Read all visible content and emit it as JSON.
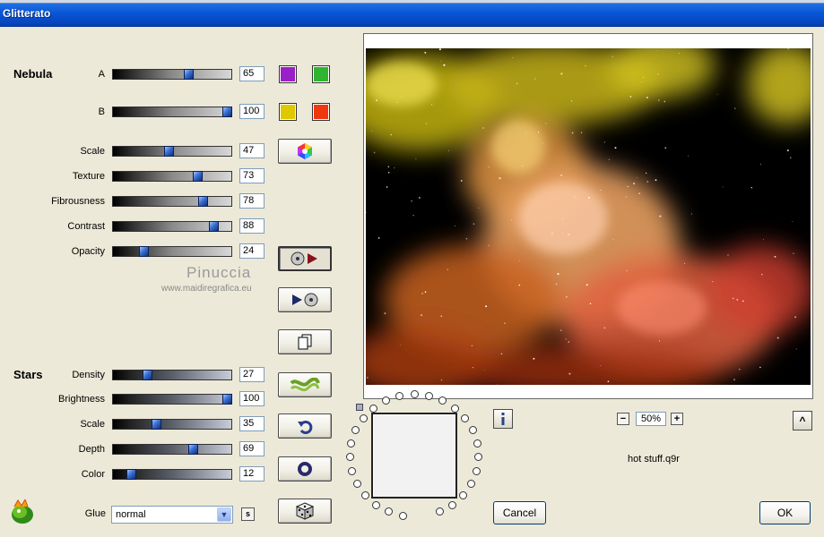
{
  "window": {
    "title": "Glitterato"
  },
  "nebula": {
    "label": "Nebula",
    "rows": [
      {
        "label": "A",
        "value": "65",
        "fraction": 0.65
      },
      {
        "label": "B",
        "value": "100",
        "fraction": 1.0
      },
      {
        "label": "Scale",
        "value": "47",
        "fraction": 0.47
      },
      {
        "label": "Texture",
        "value": "73",
        "fraction": 0.73
      },
      {
        "label": "Fibrousness",
        "value": "78",
        "fraction": 0.78
      },
      {
        "label": "Contrast",
        "value": "88",
        "fraction": 0.88
      },
      {
        "label": "Opacity",
        "value": "24",
        "fraction": 0.24
      }
    ],
    "colors": {
      "a1": "#9b1fc8",
      "a2": "#2fb52f",
      "b1": "#e0c800",
      "b2": "#f0380f"
    }
  },
  "stars": {
    "label": "Stars",
    "rows": [
      {
        "label": "Density",
        "value": "27",
        "fraction": 0.27
      },
      {
        "label": "Brightness",
        "value": "100",
        "fraction": 1.0
      },
      {
        "label": "Scale",
        "value": "35",
        "fraction": 0.35
      },
      {
        "label": "Depth",
        "value": "69",
        "fraction": 0.69
      },
      {
        "label": "Color",
        "value": "12",
        "fraction": 0.12
      }
    ]
  },
  "glue": {
    "label": "Glue",
    "selected": "normal",
    "side_button": "s"
  },
  "watermark": {
    "name": "Pinuccia",
    "url": "www.maidiregrafica.eu"
  },
  "preview": {
    "zoom": "50%",
    "filename": "hot stuff.q9r"
  },
  "icons": {
    "color-wheel": "color-wheel-icon",
    "save": "save-preset-icon",
    "load": "load-preset-icon",
    "copy": "copy-icon",
    "wave": "wave-icon",
    "undo": "undo-icon",
    "ring": "ring-icon",
    "dice": "dice-icon",
    "info": "info-icon",
    "logo": "app-logo-icon"
  },
  "buttons": {
    "cancel": "Cancel",
    "ok": "OK",
    "zoom_out": "−",
    "zoom_in": "+",
    "expand": "^"
  }
}
